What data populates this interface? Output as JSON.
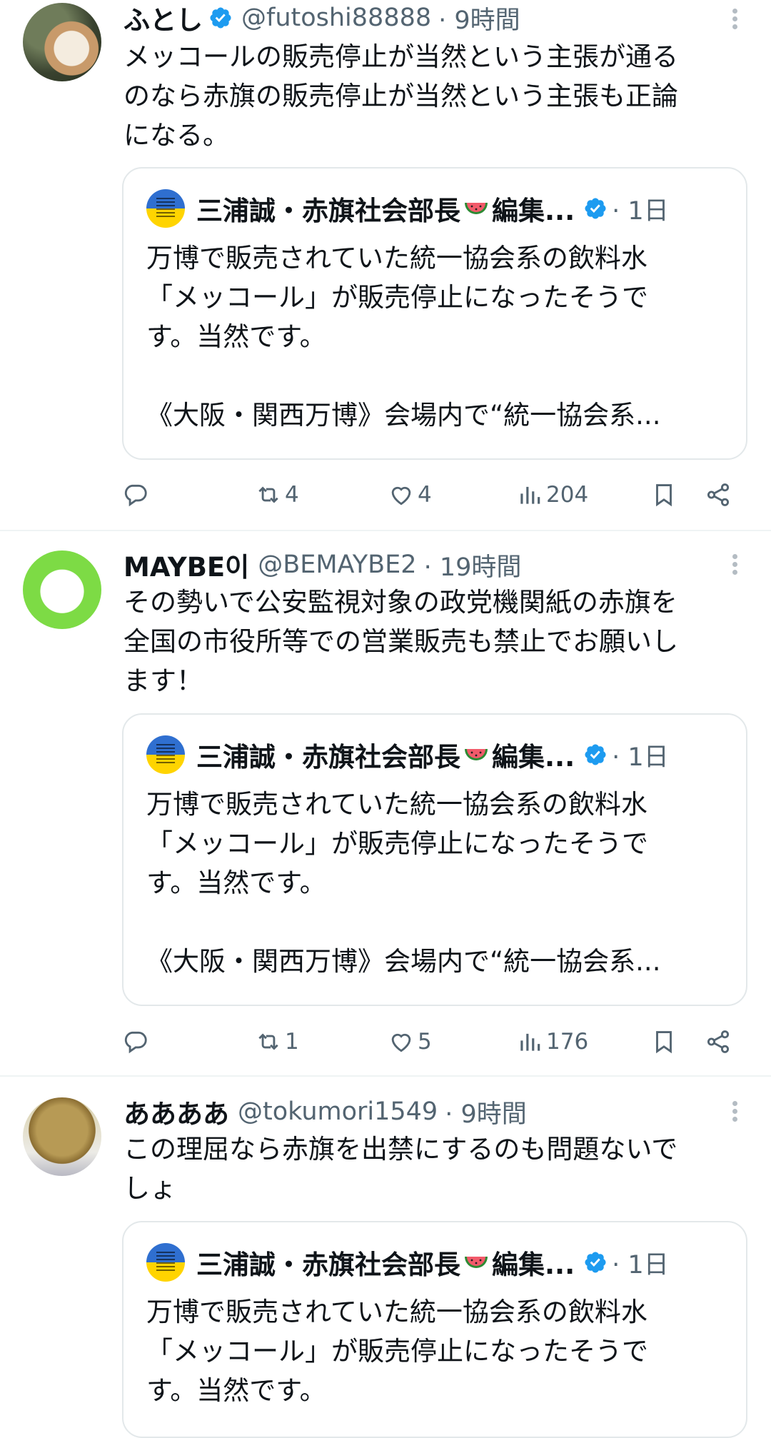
{
  "tweets": [
    {
      "name": "ふとし",
      "handle": "@futoshi88888",
      "time": "· 9時間",
      "verified": true,
      "text": "メッコールの販売停止が当然という主張が通る\nのなら赤旗の販売停止が当然という主張も正論\nになる。",
      "quote": {
        "name": "三浦誠・赤旗社会部長",
        "name_suffix": "編集...",
        "time": "· 1日",
        "text": "万博で販売されていた統一協会系の飲料水\n「メッコール」が販売停止になったそうで\nす。当然です。\n\n《大阪・関西万博》会場内で“統一協会系..."
      },
      "stats": {
        "retweets": "4",
        "likes": "4",
        "views": "204"
      }
    },
    {
      "name": "MAYBE이",
      "handle": "@BEMAYBE2",
      "time": "· 19時間",
      "verified": false,
      "text": "その勢いで公安監視対象の政党機関紙の赤旗を\n全国の市役所等での営業販売も禁止でお願いし\nます！",
      "quote": {
        "name": "三浦誠・赤旗社会部長",
        "name_suffix": "編集...",
        "time": "· 1日",
        "text": "万博で販売されていた統一協会系の飲料水\n「メッコール」が販売停止になったそうで\nす。当然です。\n\n《大阪・関西万博》会場内で“統一協会系..."
      },
      "stats": {
        "retweets": "1",
        "likes": "5",
        "views": "176"
      }
    },
    {
      "name": "ああああ",
      "handle": "@tokumori1549",
      "time": "· 9時間",
      "verified": false,
      "text": "この理屈なら赤旗を出禁にするのも問題ないで\nしょ",
      "quote": {
        "name": "三浦誠・赤旗社会部長",
        "name_suffix": "編集...",
        "time": "· 1日",
        "text": "万博で販売されていた統一協会系の飲料水\n「メッコール」が販売停止になったそうで\nす。当然です。"
      }
    }
  ],
  "icons": {
    "reply": "reply-icon",
    "retweet": "retweet-icon",
    "like": "heart-icon",
    "views": "views-icon",
    "bookmark": "bookmark-icon",
    "share": "share-icon",
    "more": "more-vertical-icon",
    "verified": "verified-badge-icon"
  },
  "colors": {
    "text": "#0f1419",
    "secondary": "#536471",
    "verified": "#1d9bf0",
    "border": "#e3e8ea"
  }
}
